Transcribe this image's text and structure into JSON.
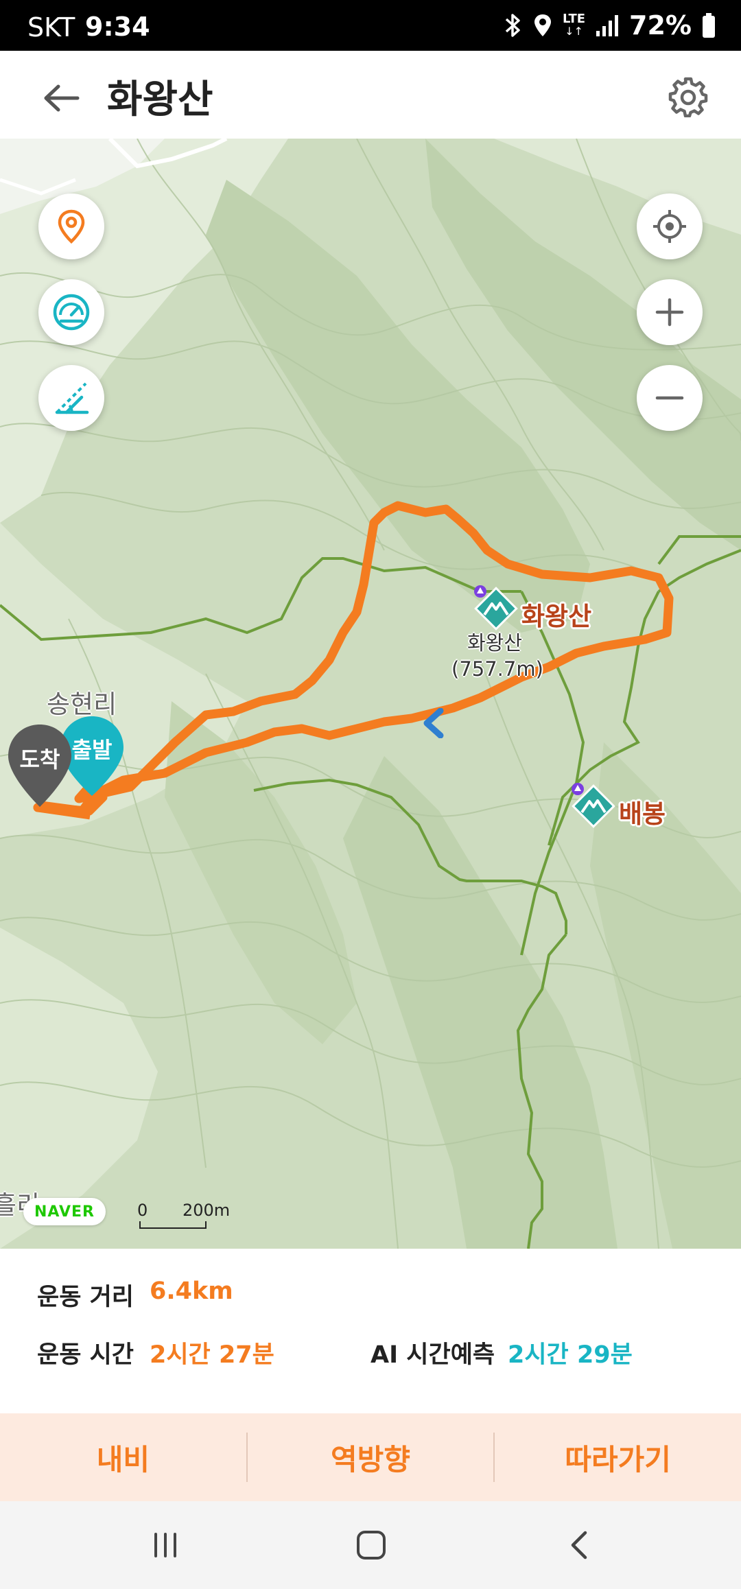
{
  "status_bar": {
    "carrier": "SKT",
    "time": "9:34",
    "network": "LTE",
    "battery": "72%",
    "icons": [
      "bluetooth-icon",
      "location-icon",
      "lte-icon",
      "signal-icon",
      "battery-icon"
    ]
  },
  "header": {
    "title": "화왕산",
    "back_icon": "back-arrow-icon",
    "settings_icon": "gear-icon"
  },
  "map": {
    "left_controls": [
      "location-pin-icon",
      "speedometer-icon",
      "slope-icon"
    ],
    "right_controls": [
      "my-location-icon",
      "zoom-in-icon",
      "zoom-out-icon"
    ],
    "peaks": [
      {
        "name": "화왕산",
        "detail_name": "화왕산",
        "elevation": "(757.7m)"
      },
      {
        "name": "배봉"
      }
    ],
    "places": [
      "송현리",
      "흘리"
    ],
    "markers": {
      "arrival": "도착",
      "departure": "출발"
    },
    "attribution": "NAVER",
    "scale": {
      "start": "0",
      "end": "200m"
    },
    "colors": {
      "route": "#f47c20",
      "trail": "#6e9e3c",
      "departure": "#19b5c4",
      "arrival": "#5a5a5a"
    }
  },
  "stats": {
    "distance_label": "운동 거리",
    "distance_value": "6.4km",
    "time_label": "운동 시간",
    "time_value": "2시간 27분",
    "ai_label": "AI 시간예측",
    "ai_value": "2시간 29분"
  },
  "actions": {
    "navigate": "내비",
    "reverse": "역방향",
    "follow": "따라가기"
  },
  "nav_bar": [
    "recent-apps-icon",
    "home-icon",
    "back-icon"
  ]
}
